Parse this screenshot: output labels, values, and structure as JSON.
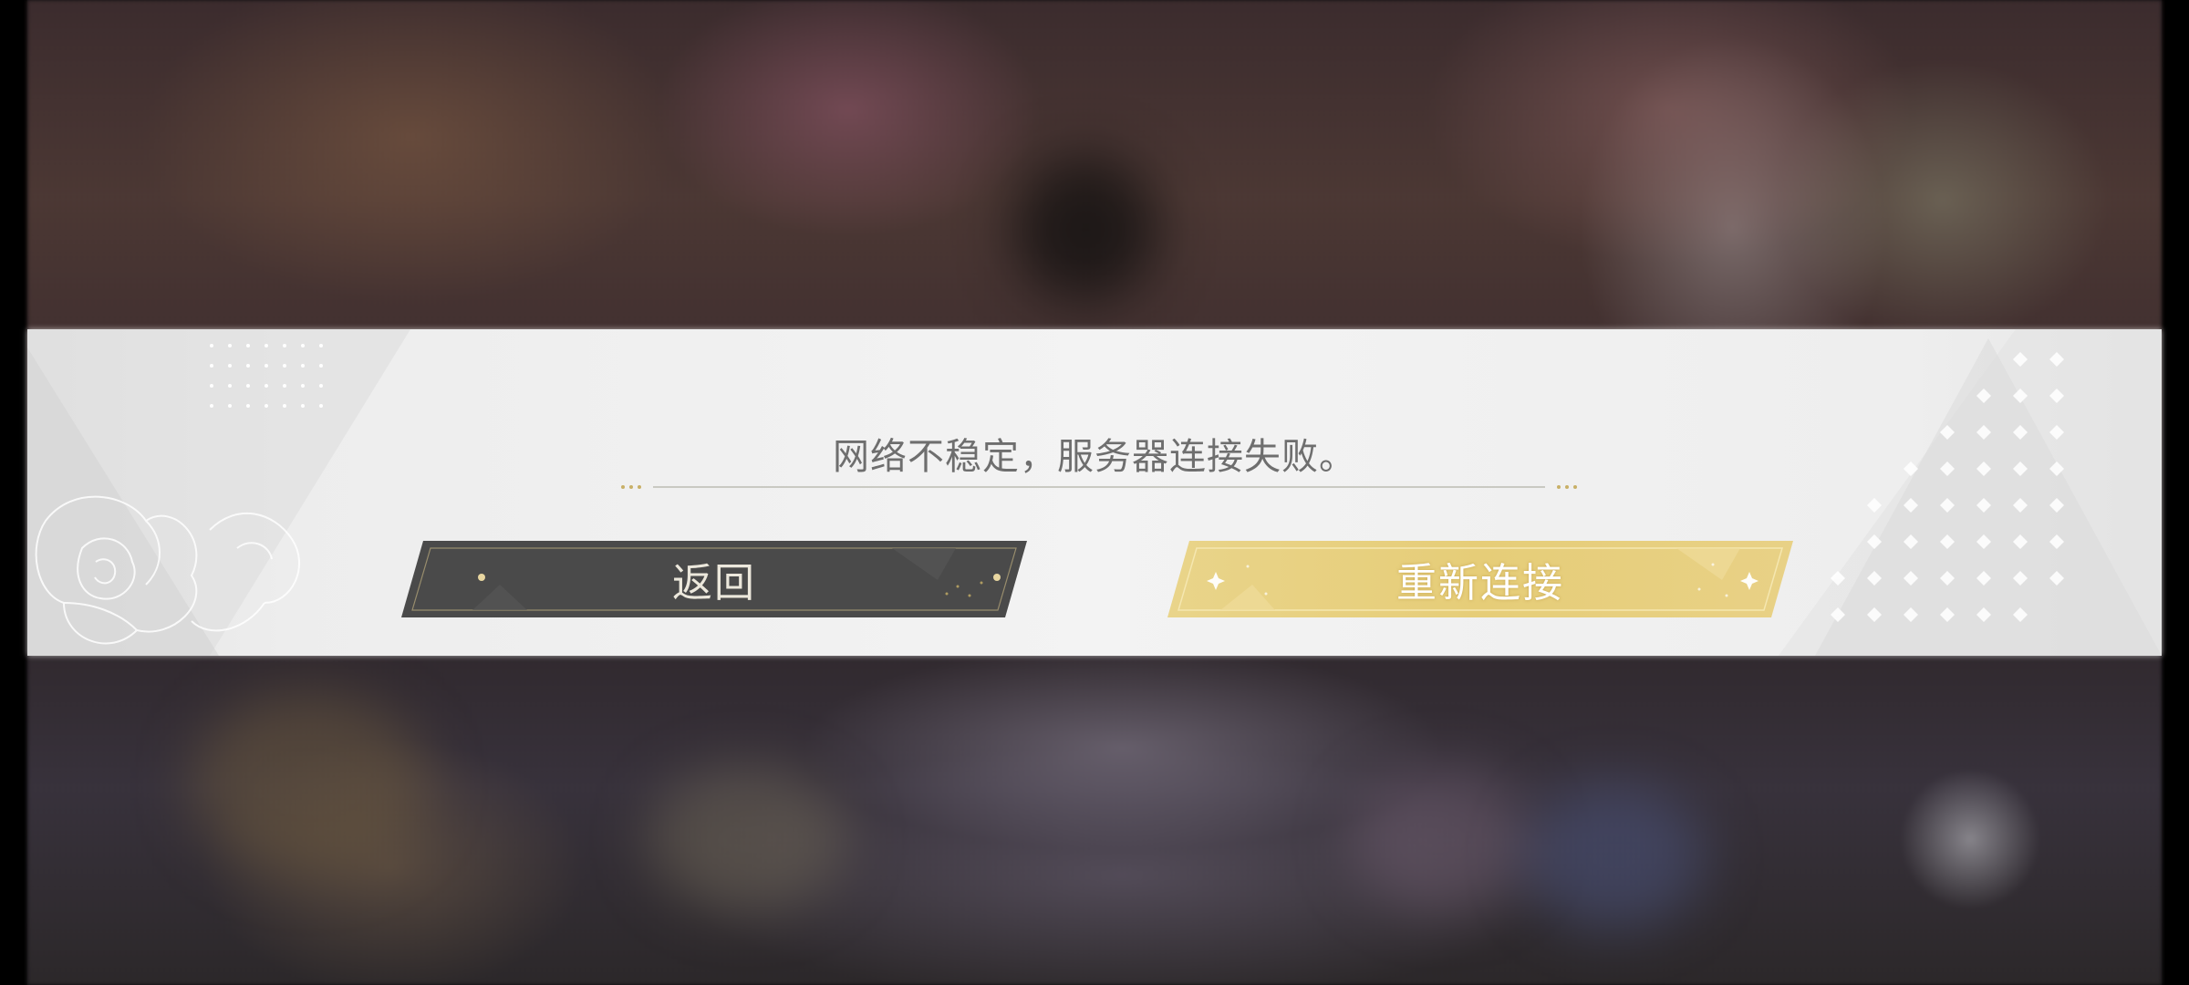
{
  "dialog": {
    "message": "网络不稳定，服务器连接失败。",
    "back_label": "返回",
    "reconnect_label": "重新连接"
  },
  "colors": {
    "dialog_background": "#f1f1f1",
    "message_text": "#6e6e6e",
    "back_button": "#4a4a4a",
    "back_button_border": "#b9a97c",
    "reconnect_button": "#e6cf7e",
    "reconnect_button_border": "#f5e7b0",
    "accent_gold": "#c8b067"
  },
  "icons": {
    "sparkle": "sparkle-icon",
    "rose": "rose-line-art",
    "diamond_pattern": "diamond-pattern"
  }
}
